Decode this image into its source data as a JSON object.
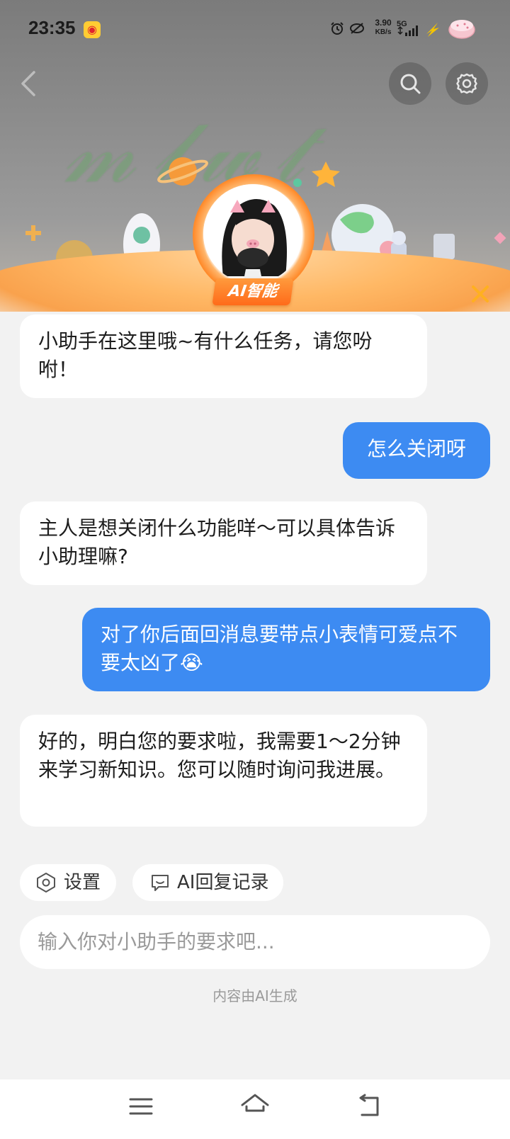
{
  "status_bar": {
    "time": "23:35",
    "net_speed_value": "3.90",
    "net_speed_unit": "KB/s",
    "network_type": "5G",
    "icons": [
      "weibo-icon",
      "alarm-icon",
      "nfc-icon",
      "signal-icon",
      "charging-icon",
      "battery-icon"
    ]
  },
  "header": {
    "badge_label": "AI智能",
    "icons": [
      "back-arrow-icon",
      "search-icon",
      "gear-icon",
      "close-icon"
    ],
    "colors": {
      "badge": "#ff7a22",
      "close": "#ffb020"
    }
  },
  "chat": {
    "messages": [
      {
        "role": "bot",
        "text": "小助手在这里哦~有什么任务，请您吩咐！"
      },
      {
        "role": "user",
        "text": "怎么关闭呀"
      },
      {
        "role": "bot",
        "text": "主人是想关闭什么功能咩～可以具体告诉小助理嘛?"
      },
      {
        "role": "user",
        "text": "对了你后面回消息要带点小表情可爱点不要太凶了😭"
      },
      {
        "role": "bot",
        "text": "好的，明白您的要求啦，我需要1～2分钟来学习新知识。您可以随时询问我进展。"
      }
    ],
    "colors": {
      "user_bubble": "#3d8bf2",
      "bot_bubble": "#ffffff"
    }
  },
  "quick_actions": {
    "settings_label": "设置",
    "history_label": "AI回复记录"
  },
  "input": {
    "placeholder": "输入你对小助手的要求吧..."
  },
  "footer_note": "内容由AI生成",
  "nav_bar": {
    "icons": [
      "menu-icon",
      "home-icon",
      "back-icon"
    ]
  }
}
